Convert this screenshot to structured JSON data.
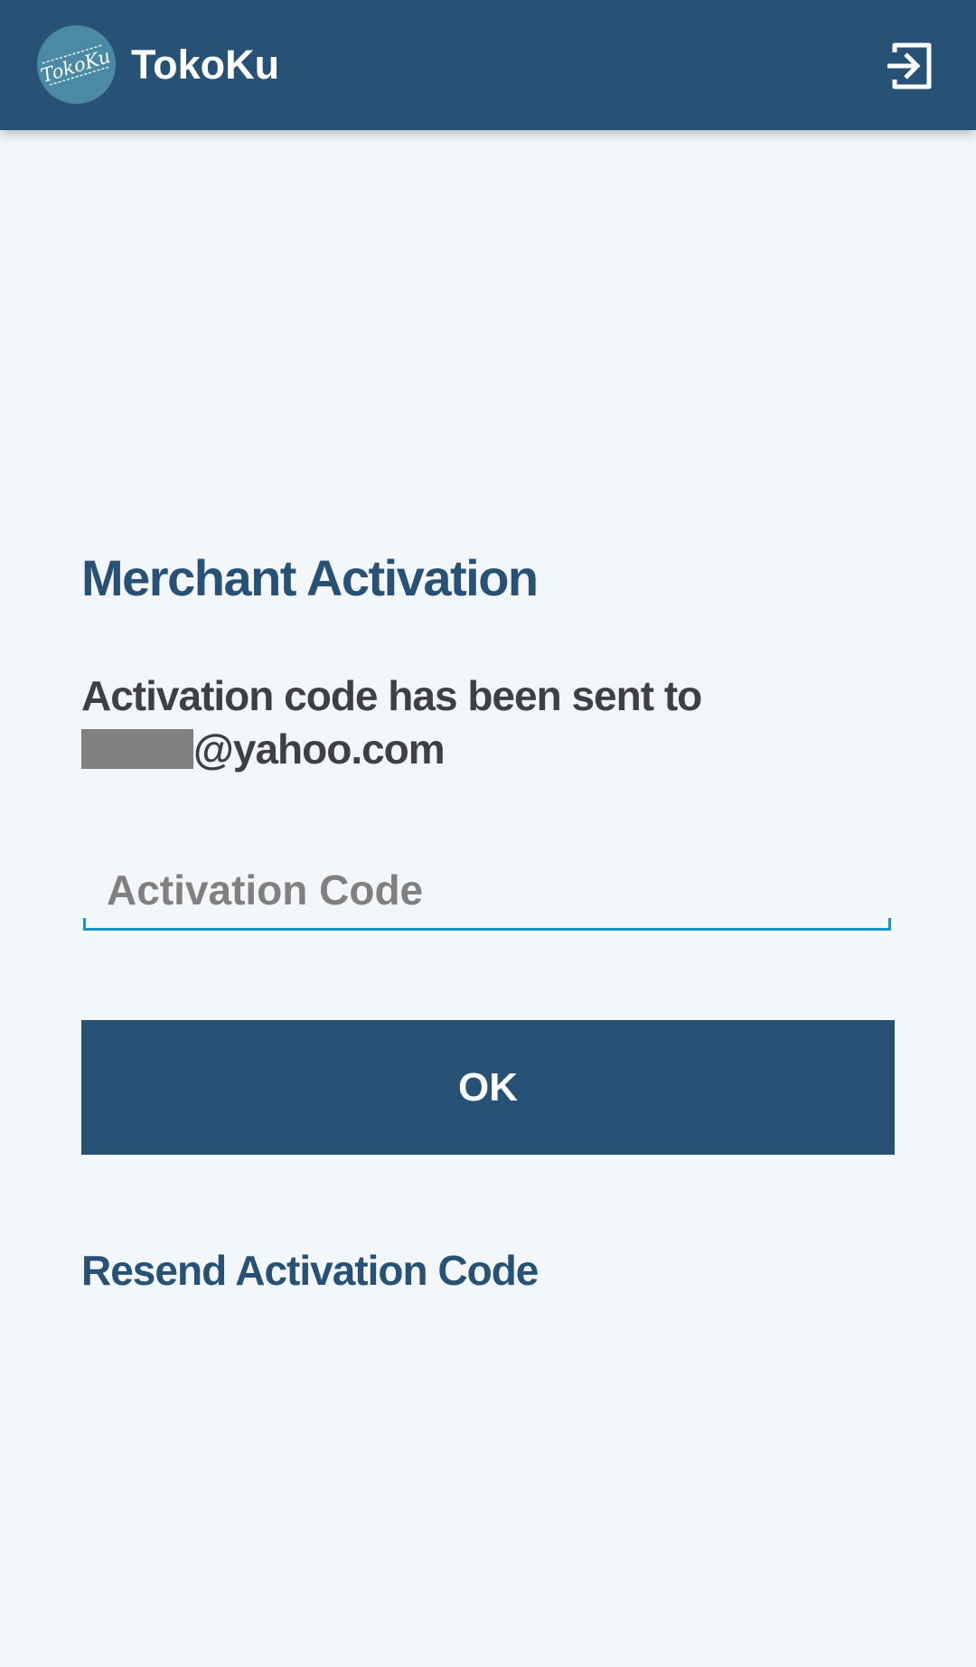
{
  "app_bar": {
    "title": "TokoKu",
    "logo_text": "TokoKu",
    "logout_icon": "exit-to-app-icon"
  },
  "activation": {
    "heading": "Merchant Activation",
    "message": "Activation code has been sent to",
    "email_suffix": "@yahoo.com",
    "code_placeholder": "Activation Code",
    "code_value": "",
    "ok_label": "OK",
    "resend_label": "Resend Activation Code"
  },
  "colors": {
    "primary": "#285275",
    "background": "#f4f7fa",
    "accent": "#1b93c5",
    "text": "#3f3f47",
    "redacted": "#808080"
  }
}
